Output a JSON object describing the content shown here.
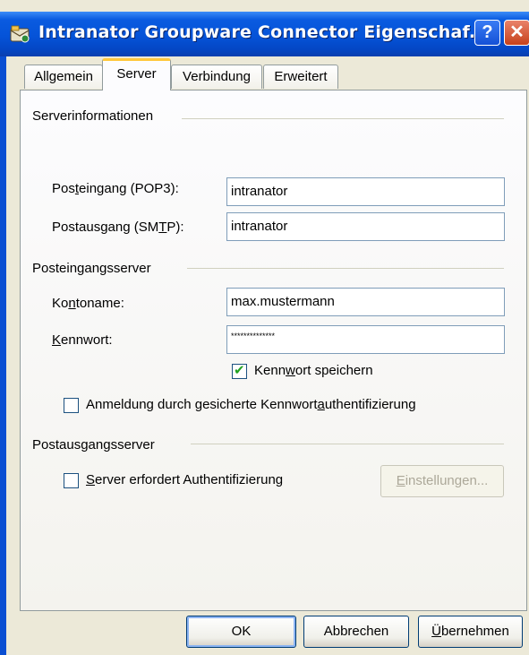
{
  "window": {
    "title": "Intranator Groupware Connector Eigenschaf...",
    "help_symbol": "?",
    "close_symbol": "✕"
  },
  "tabs": [
    {
      "label": "Allgemein"
    },
    {
      "label": "Server"
    },
    {
      "label": "Verbindung"
    },
    {
      "label": "Erweitert"
    }
  ],
  "server_info": {
    "group_label": "Serverinformationen",
    "incoming_label_pre": "Pos",
    "incoming_label_accel": "t",
    "incoming_label_post": "eingang (POP3):",
    "incoming_value": "intranator",
    "outgoing_label_pre": "Postausgang (SM",
    "outgoing_label_accel": "T",
    "outgoing_label_post": "P):",
    "outgoing_value": "intranator"
  },
  "incoming_server": {
    "group_label": "Posteingangsserver",
    "account_label_pre": "Ko",
    "account_label_accel": "n",
    "account_label_post": "toname:",
    "account_value": "max.mustermann",
    "password_label_accel": "K",
    "password_label_post": "ennwort:",
    "password_value": "**************",
    "save_password_pre": "Kenn",
    "save_password_accel": "w",
    "save_password_post": "ort speichern",
    "save_password_checked": true,
    "spa_pre": "Anmeldung durch gesicherte Kennwort",
    "spa_accel": "a",
    "spa_post": "uthentifizierung",
    "spa_checked": false
  },
  "outgoing_server": {
    "group_label": "Postausgangsserver",
    "auth_accel": "S",
    "auth_post": "erver erfordert Authentifizierung",
    "auth_checked": false,
    "settings_accel": "E",
    "settings_post": "instellungen..."
  },
  "buttons": {
    "ok": "OK",
    "cancel": "Abbrechen",
    "apply_accel": "Ü",
    "apply_post": "bernehmen"
  }
}
